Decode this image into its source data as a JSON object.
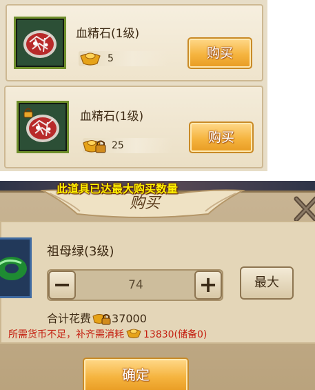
{
  "shop": {
    "items": [
      {
        "name": "血精石(1级)",
        "price": "5",
        "currency_icon": "gold-ingot-icon",
        "buy_label": "购买"
      },
      {
        "name": "血精石(1级)",
        "price": "25",
        "currency_icon": "locked-gold-ingot-icon",
        "buy_label": "购买"
      }
    ]
  },
  "dialog": {
    "notice": "此道具已达最大购买数量",
    "title": "购买",
    "item_name": "祖母绿(3级)",
    "quantity": "74",
    "minus_label": "−",
    "plus_label": "+",
    "max_label": "最大",
    "total_label": "合计花费",
    "total_value": "37000",
    "warning_text": "所需货币不足，补齐需消耗",
    "warning_value": "13830(储备0)",
    "confirm_label": "确定"
  },
  "colors": {
    "button_gold": "#f5b43f",
    "notice_yellow": "#fff200",
    "warning_red": "#c41f10"
  }
}
